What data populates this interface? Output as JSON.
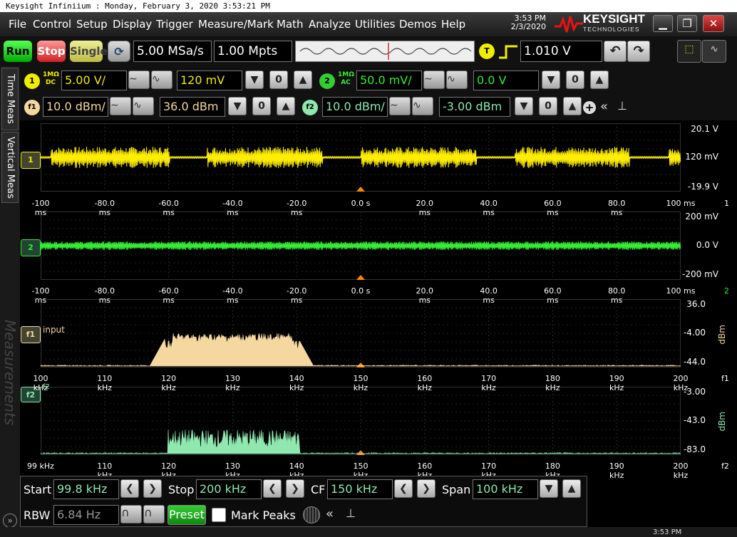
{
  "window": {
    "title": "Keysight Infiniium : Monday, February 3, 2020 3:53:21 PM",
    "time": "3:53 PM",
    "date": "2/3/2020",
    "logo_main": "KEYSIGHT",
    "logo_sub": "TECHNOLOGIES"
  },
  "menu": [
    "File",
    "Control",
    "Setup",
    "Display",
    "Trigger",
    "Measure/Mark",
    "Math",
    "Analyze",
    "Utilities",
    "Demos",
    "Help"
  ],
  "acq": {
    "run": "Run",
    "stop": "Stop",
    "single": "Single",
    "rate": "5.00 MSa/s",
    "points": "1.00 Mpts",
    "trigger_badge": "T",
    "trigger_level": "1.010 V"
  },
  "ch1": {
    "num": "1",
    "coupling": "1MΩ DC",
    "scale": "5.00 V/",
    "offset": "120 mV",
    "color": "#ffee00"
  },
  "ch2": {
    "num": "2",
    "coupling": "1MΩ AC",
    "scale": "50.0 mV/",
    "offset": "0.0 V",
    "color": "#33ee33"
  },
  "f1": {
    "num": "f1",
    "scale": "10.0 dBm/",
    "offset": "36.0 dBm",
    "color": "#f5d8a0"
  },
  "f2": {
    "num": "f2",
    "scale": "10.0 dBm/",
    "offset": "-3.00 dBm",
    "color": "#8fe8b0"
  },
  "side_tabs": [
    "Time Meas",
    "Vertical Meas",
    "Measurements"
  ],
  "waveforms": [
    {
      "name": "ch1",
      "top": "20.1 V",
      "mid": "120 mV",
      "bottom": "-19.9 V",
      "marker": "1"
    },
    {
      "name": "ch2",
      "top": "200 mV",
      "mid": "0.0 V",
      "bottom": "-200 mV",
      "marker": "2"
    },
    {
      "name": "f1",
      "top": "36.0",
      "mid": "-4.00",
      "bottom": "-44.0",
      "unit": "dBm",
      "marker": "f1",
      "label": "input"
    },
    {
      "name": "f2",
      "top": "-3.00",
      "mid": "-43.0",
      "bottom": "-83.0",
      "unit": "dBm",
      "marker": "f2",
      "label": "f2"
    }
  ],
  "time_axis": [
    "-100 ms",
    "-80.0 ms",
    "-60.0 ms",
    "-40.0 ms",
    "-20.0 ms",
    "0.0 s",
    "20.0 ms",
    "40.0 ms",
    "60.0 ms",
    "80.0 ms",
    "100 ms"
  ],
  "freq_axis_f1": [
    "100 kHz",
    "110 kHz",
    "120 kHz",
    "130 kHz",
    "140 kHz",
    "150 kHz",
    "160 kHz",
    "170 kHz",
    "180 kHz",
    "190 kHz",
    "200 kHz"
  ],
  "freq_axis_f2": [
    "99 kHz",
    "110 kHz",
    "120 kHz",
    "130 kHz",
    "140 kHz",
    "150 kHz",
    "160 kHz",
    "170 kHz",
    "180 kHz",
    "190 kHz",
    "200 kHz"
  ],
  "axis_tags": {
    "ch1": "1",
    "ch2": "2",
    "f1": "f1",
    "f2": "f2"
  },
  "fft": {
    "start_label": "Start",
    "start": "99.8 kHz",
    "stop_label": "Stop",
    "stop": "200 kHz",
    "cf_label": "CF",
    "cf": "150 kHz",
    "span_label": "Span",
    "span": "100 kHz",
    "rbw_label": "RBW",
    "rbw": "6.84 Hz",
    "preset": "Preset",
    "mark_peaks": "Mark Peaks"
  },
  "status": {
    "time": "3:53 PM"
  }
}
